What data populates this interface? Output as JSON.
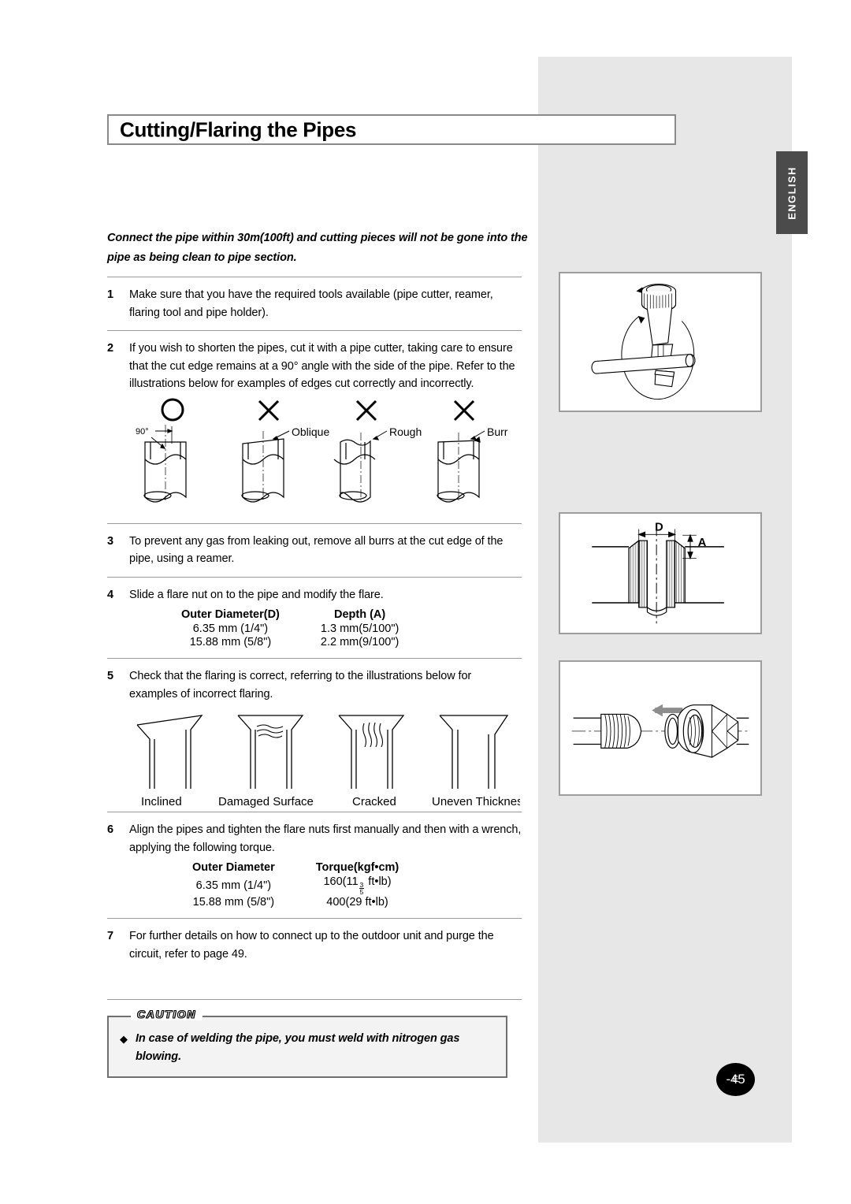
{
  "page": {
    "title": "Cutting/Flaring the Pipes",
    "language_tab": "ENGLISH",
    "page_number_prefix": "E",
    "page_number": "-45"
  },
  "intro": {
    "text": "Connect the pipe within 30m(100ft) and cutting pieces will not be gone into the pipe as being clean to pipe section."
  },
  "steps": [
    {
      "num": "1",
      "text": "Make sure that you have the required tools available (pipe cutter, reamer, flaring tool and pipe holder)."
    },
    {
      "num": "2",
      "text": "If you wish to shorten the pipes, cut it with a pipe cutter, taking care to ensure that the cut edge remains at a 90° angle with the side of the pipe. Refer to the illustrations below for examples of edges cut correctly and incorrectly."
    },
    {
      "num": "3",
      "text": "To prevent any gas from leaking out, remove all burrs at the cut edge of the pipe, using a reamer."
    },
    {
      "num": "4",
      "text": "Slide a flare nut on to the pipe and modify the flare."
    },
    {
      "num": "5",
      "text": "Check that the flaring is correct, referring to the illustrations below for examples of incorrect flaring."
    },
    {
      "num": "6",
      "text": "Align the pipes and tighten the flare nuts first manually and then with a wrench, applying the following torque."
    },
    {
      "num": "7",
      "text": "For further details on how to connect up to the outdoor unit and purge the circuit, refer to page 49."
    }
  ],
  "cut_edge_figures": {
    "marks": [
      "O",
      "X",
      "X",
      "X"
    ],
    "angle_label": "90°",
    "labels": [
      "",
      "Oblique",
      "Rough",
      "Burr"
    ]
  },
  "flare_figures": {
    "labels": [
      "Inclined",
      "Damaged Surface",
      "Cracked",
      "Uneven Thickness"
    ]
  },
  "depth_table": {
    "headers": [
      "Outer Diameter(D)",
      "Depth (A)"
    ],
    "rows": [
      [
        "6.35 mm (1/4\")",
        "1.3 mm(5/100\")"
      ],
      [
        "15.88 mm (5/8\")",
        "2.2 mm(9/100\")"
      ]
    ]
  },
  "torque_table": {
    "headers": [
      "Outer Diameter",
      "Torque(kgf•cm)"
    ],
    "rows": [
      {
        "diameter": "6.35 mm (1/4\")",
        "torque_prefix": "160(11",
        "torque_fraction_num": "3",
        "torque_fraction_den": "5",
        "torque_suffix": " ft•lb)"
      },
      {
        "diameter": "15.88 mm (5/8\")",
        "torque_prefix": "400(29 ft•lb)",
        "torque_fraction_num": "",
        "torque_fraction_den": "",
        "torque_suffix": ""
      }
    ]
  },
  "caution": {
    "label": "CAUTION",
    "bullet": "◆",
    "text": "In case of welding the pipe, you must weld with nitrogen gas blowing."
  },
  "figures": {
    "depth_diagram": {
      "dim_d": "D",
      "dim_a": "A"
    }
  },
  "colors": {
    "gray_panel": "#e7e7e7",
    "tab": "#4b4b4b",
    "box_border": "#9d9d9d",
    "rule": "#9a9a9a"
  }
}
